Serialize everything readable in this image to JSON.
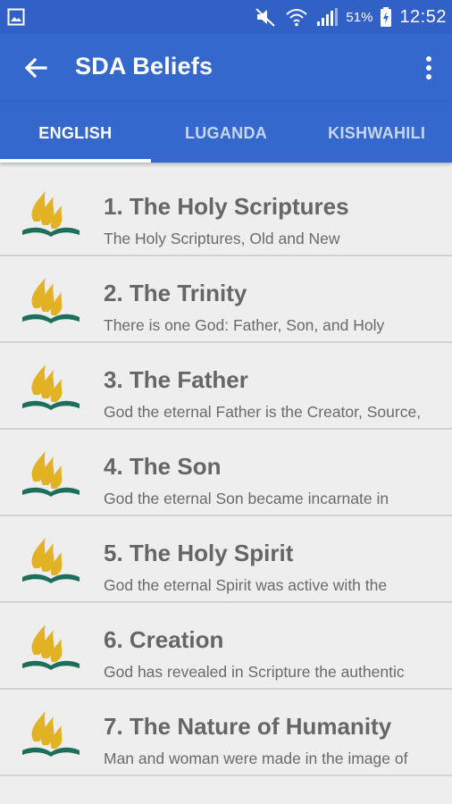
{
  "status_bar": {
    "battery_percent": "51%",
    "time": "12:52",
    "icons": [
      "gallery-icon",
      "mute-icon",
      "wifi-icon",
      "signal-icon",
      "battery-charging-icon"
    ]
  },
  "app_bar": {
    "title": "SDA Beliefs",
    "back_icon": "arrow-back-icon",
    "menu_icon": "more-vert-icon"
  },
  "tabs": [
    {
      "label": "ENGLISH",
      "active": true
    },
    {
      "label": "LUGANDA",
      "active": false
    },
    {
      "label": "KISHWAHILI",
      "active": false
    }
  ],
  "beliefs": [
    {
      "title": "1. The Holy Scriptures",
      "snippet": "The Holy Scriptures, Old and New"
    },
    {
      "title": "2. The Trinity",
      "snippet": "There is one God: Father, Son, and Holy"
    },
    {
      "title": "3. The Father",
      "snippet": "God the eternal Father is the Creator, Source,"
    },
    {
      "title": "4. The Son",
      "snippet": "God the eternal Son became incarnate in"
    },
    {
      "title": "5. The Holy Spirit",
      "snippet": "God the eternal Spirit was active with the"
    },
    {
      "title": "6. Creation",
      "snippet": "God has revealed in Scripture the authentic"
    },
    {
      "title": "7. The Nature of Humanity",
      "snippet": "Man and woman were made in the image of"
    }
  ],
  "colors": {
    "primary": "#3568cc",
    "primary_dark": "#3160c6",
    "logo_gold": "#e0b224",
    "logo_green": "#1d6e5a",
    "title_text": "#666666"
  }
}
